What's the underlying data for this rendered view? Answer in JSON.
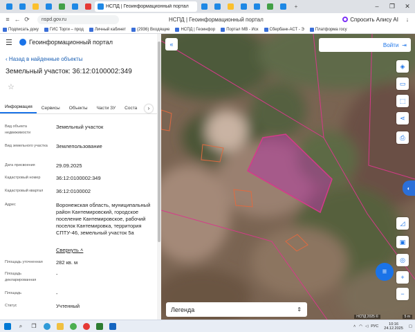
{
  "browser": {
    "url": "nspd.gov.ru",
    "page_title": "НСПД | Геоинформационный портал",
    "alice_label": "Спросить Алису AI",
    "window_controls": [
      "–",
      "❐",
      "✕"
    ]
  },
  "bookmarks": [
    "Подписать доку",
    "ГИС Торги – прод",
    "Личный кабинет",
    "(2936) Входящие",
    "НСПД | Геоинфор",
    "Портал МВ - Иск",
    "Сбербанк-АСТ - Э",
    "Платформа госу"
  ],
  "sidebar": {
    "brand": "Геоинформационный портал",
    "back_link": "Назад в найденные объекты",
    "object_title": "Земельный участок: 36:12:0100002:349",
    "tabs": [
      "Информация",
      "Сервисы",
      "Объекты",
      "Части ЗУ",
      "Соста"
    ],
    "props": {
      "obj_type_k": "Вид объекта недвижимости",
      "obj_type_v": "Земельный участок",
      "land_type_k": "Вид земельного участка",
      "land_type_v": "Землепользование",
      "date_k": "Дата присвоения",
      "date_v": "29.09.2025",
      "cad_num_k": "Кадастровый номер",
      "cad_num_v": "36:12:0100002:349",
      "cad_q_k": "Кадастровый квартал",
      "cad_q_v": "36:12:0100002",
      "addr_k": "Адрес",
      "addr_v": "Воронежская область, муниципальный район Кантемировский, городское поселение Кантемировское, рабочий поселок Кантемировка, территория СПТУ-46, земельный участок 5а",
      "collapse": "Свернуть",
      "area_spec_k": "Площадь уточненная",
      "area_spec_v": "282 кв. м",
      "area_decl_k": "Площадь декларированная",
      "area_decl_v": "-",
      "area_k": "Площадь",
      "area_v": "-",
      "status_k": "Статус",
      "status_v": "Учтенный"
    }
  },
  "map": {
    "login_label": "Войти",
    "legend_label": "Легенда",
    "attribution": "НСПД 2025 ©",
    "scale": "5 m"
  },
  "taskbar": {
    "time": "10:16",
    "date": "24.12.2025",
    "lang": "РУС"
  },
  "colors": {
    "accent": "#1a73e8",
    "parcel_outline": "#d63a8a",
    "parcel_fill": "#b03aa0"
  }
}
